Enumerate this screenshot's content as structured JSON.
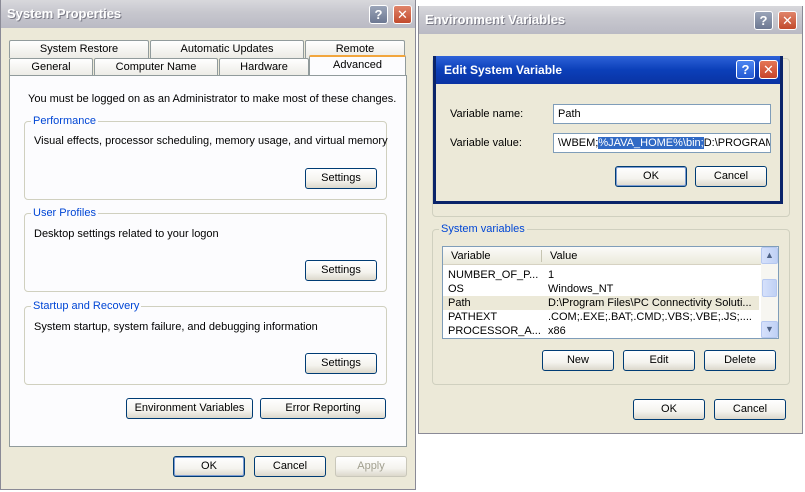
{
  "system_properties": {
    "title": "System Properties",
    "tabs_row1": [
      "System Restore",
      "Automatic Updates",
      "Remote"
    ],
    "tabs_row2": [
      "General",
      "Computer Name",
      "Hardware",
      "Advanced"
    ],
    "active_tab": "Advanced",
    "admin_notice": "You must be logged on as an Administrator to make most of these changes.",
    "performance": {
      "label": "Performance",
      "description": "Visual effects, processor scheduling, memory usage, and virtual memory",
      "button": "Settings"
    },
    "user_profiles": {
      "label": "User Profiles",
      "description": "Desktop settings related to your logon",
      "button": "Settings"
    },
    "startup_recovery": {
      "label": "Startup and Recovery",
      "description": "System startup, system failure, and debugging information",
      "button": "Settings"
    },
    "env_vars_button": "Environment Variables",
    "error_reporting_button": "Error Reporting",
    "ok": "OK",
    "cancel": "Cancel",
    "apply": "Apply"
  },
  "env_vars": {
    "title": "Environment Variables",
    "system_vars_label": "System variables",
    "columns": [
      "Variable",
      "Value"
    ],
    "rows": [
      {
        "variable": "NUMBER_OF_P...",
        "value": "1"
      },
      {
        "variable": "OS",
        "value": "Windows_NT"
      },
      {
        "variable": "Path",
        "value": "D:\\Program Files\\PC Connectivity Soluti..."
      },
      {
        "variable": "PATHEXT",
        "value": ".COM;.EXE;.BAT;.CMD;.VBS;.VBE;.JS;...."
      },
      {
        "variable": "PROCESSOR_A...",
        "value": "x86"
      }
    ],
    "new": "New",
    "edit": "Edit",
    "delete": "Delete",
    "ok": "OK",
    "cancel": "Cancel"
  },
  "edit_dialog": {
    "title": "Edit System Variable",
    "name_label": "Variable name:",
    "name_value": "Path",
    "value_label": "Variable value:",
    "value_before": "\\WBEM;",
    "value_selected": "%JAVA_HOME%\\bin;",
    "value_after": "D:\\PROGRAM",
    "ok": "OK",
    "cancel": "Cancel"
  },
  "colors": {
    "title_text": "#ffffff",
    "dialog_title": "#0a246a",
    "selection": "#316ac5",
    "group_label": "#0046d5"
  },
  "icons": {
    "help": "help-icon",
    "close": "close-icon",
    "scroll_up": "chevron-up-icon",
    "scroll_down": "chevron-down-icon"
  }
}
